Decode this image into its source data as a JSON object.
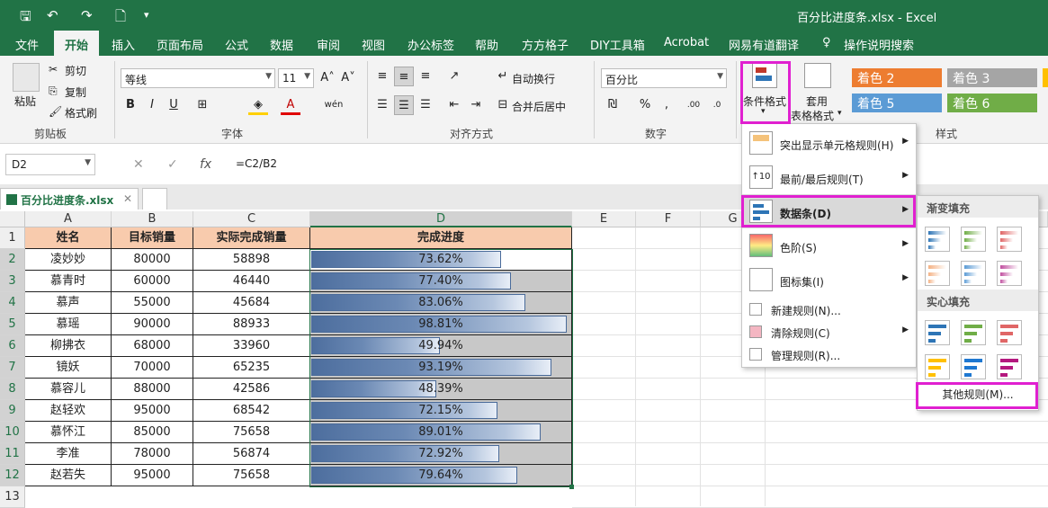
{
  "window": {
    "title": "百分比进度条.xlsx - Excel"
  },
  "menu": [
    "文件",
    "开始",
    "插入",
    "页面布局",
    "公式",
    "数据",
    "审阅",
    "视图",
    "办公标签",
    "帮助",
    "方方格子",
    "DIY工具箱",
    "Acrobat",
    "网易有道翻译",
    "操作说明搜索"
  ],
  "ribbon": {
    "clipboard": {
      "label": "剪贴板",
      "paste": "粘贴",
      "cut": "剪切",
      "copy": "复制",
      "format_painter": "格式刷"
    },
    "font": {
      "label": "字体",
      "name": "等线",
      "size": "11"
    },
    "alignment": {
      "label": "对齐方式",
      "wrap": "自动换行",
      "merge": "合并后居中"
    },
    "number": {
      "label": "数字",
      "format": "百分比"
    },
    "styles": {
      "label": "样式",
      "cond_format": "条件格式",
      "table_format_1": "套用",
      "table_format_2": "表格格式",
      "accents": [
        "着色 2",
        "着色 3",
        "着色 5",
        "着色 6"
      ]
    }
  },
  "formula_bar": {
    "name_box": "D2",
    "fx": "fx",
    "formula": "=C2/B2"
  },
  "sheet_tab": {
    "file": "百分比进度条.xlsx"
  },
  "columns": [
    "A",
    "B",
    "C",
    "D",
    "E",
    "F",
    "G"
  ],
  "rows": [
    "1",
    "2",
    "3",
    "4",
    "5",
    "6",
    "7",
    "8",
    "9",
    "10",
    "11",
    "12",
    "13"
  ],
  "table": {
    "headers": [
      "姓名",
      "目标销量",
      "实际完成销量",
      "完成进度"
    ],
    "rows": [
      {
        "name": "凌妙妙",
        "target": "80000",
        "actual": "58898",
        "progress": "73.62%",
        "ratio": 0.7362
      },
      {
        "name": "慕青时",
        "target": "60000",
        "actual": "46440",
        "progress": "77.40%",
        "ratio": 0.774
      },
      {
        "name": "慕声",
        "target": "55000",
        "actual": "45684",
        "progress": "83.06%",
        "ratio": 0.8306
      },
      {
        "name": "慕瑶",
        "target": "90000",
        "actual": "88933",
        "progress": "98.81%",
        "ratio": 0.9881
      },
      {
        "name": "柳拂衣",
        "target": "68000",
        "actual": "33960",
        "progress": "49.94%",
        "ratio": 0.4994
      },
      {
        "name": "镜妖",
        "target": "70000",
        "actual": "65235",
        "progress": "93.19%",
        "ratio": 0.9319
      },
      {
        "name": "慕容儿",
        "target": "88000",
        "actual": "42586",
        "progress": "48.39%",
        "ratio": 0.4839
      },
      {
        "name": "赵轻欢",
        "target": "95000",
        "actual": "68542",
        "progress": "72.15%",
        "ratio": 0.7215
      },
      {
        "name": "慕怀江",
        "target": "85000",
        "actual": "75658",
        "progress": "89.01%",
        "ratio": 0.8901
      },
      {
        "name": "李准",
        "target": "78000",
        "actual": "56874",
        "progress": "72.92%",
        "ratio": 0.7292
      },
      {
        "name": "赵若失",
        "target": "95000",
        "actual": "75658",
        "progress": "79.64%",
        "ratio": 0.7964
      }
    ]
  },
  "cond_menu": {
    "items": [
      "突出显示单元格规则(H)",
      "最前/最后规则(T)",
      "数据条(D)",
      "色阶(S)",
      "图标集(I)"
    ],
    "small_items": [
      "新建规则(N)...",
      "清除规则(C)",
      "管理规则(R)..."
    ]
  },
  "databar_menu": {
    "gradient": "渐变填充",
    "solid": "实心填充",
    "more": "其他规则(M)..."
  }
}
